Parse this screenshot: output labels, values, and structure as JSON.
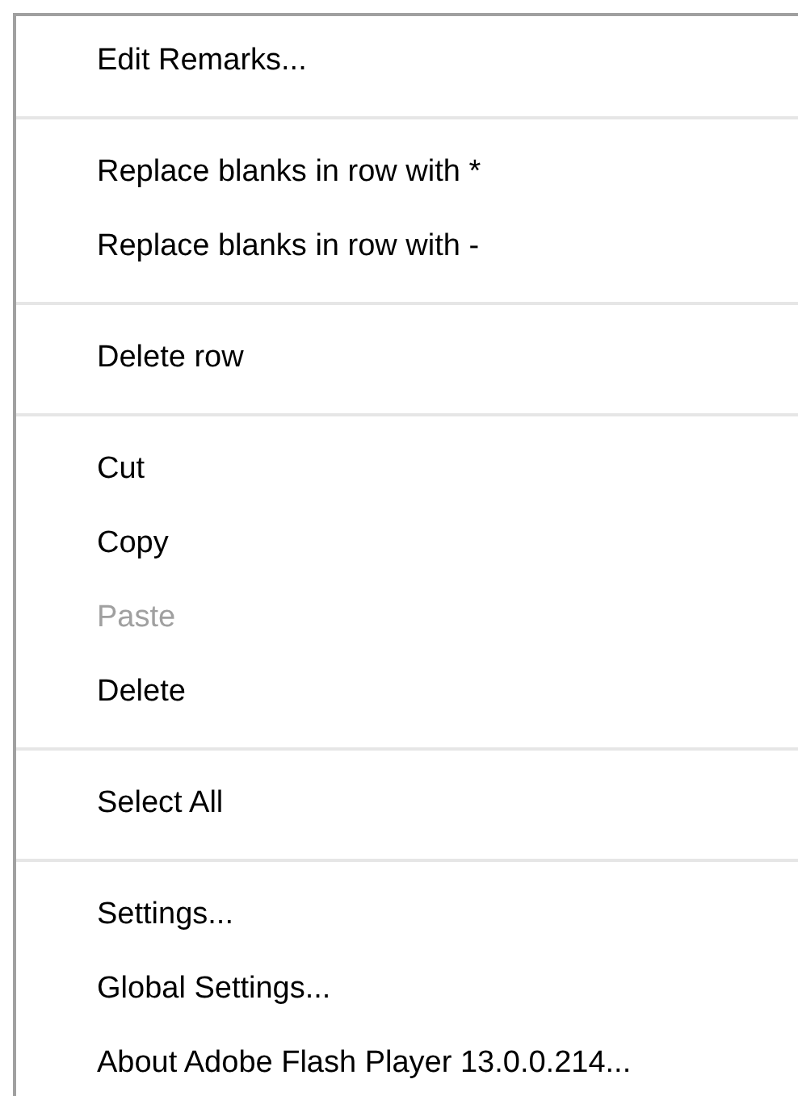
{
  "context_menu": {
    "entries": [
      {
        "kind": "item",
        "label": "Edit Remarks...",
        "disabled": false
      },
      {
        "kind": "separator"
      },
      {
        "kind": "item",
        "label": "Replace blanks in row with *",
        "disabled": false
      },
      {
        "kind": "item",
        "label": "Replace blanks in row with -",
        "disabled": false
      },
      {
        "kind": "separator"
      },
      {
        "kind": "item",
        "label": "Delete row",
        "disabled": false
      },
      {
        "kind": "separator"
      },
      {
        "kind": "item",
        "label": "Cut",
        "disabled": false
      },
      {
        "kind": "item",
        "label": "Copy",
        "disabled": false
      },
      {
        "kind": "item",
        "label": "Paste",
        "disabled": true
      },
      {
        "kind": "item",
        "label": "Delete",
        "disabled": false
      },
      {
        "kind": "separator"
      },
      {
        "kind": "item",
        "label": "Select All",
        "disabled": false
      },
      {
        "kind": "separator"
      },
      {
        "kind": "item",
        "label": "Settings...",
        "disabled": false
      },
      {
        "kind": "item",
        "label": "Global Settings...",
        "disabled": false
      },
      {
        "kind": "item",
        "label": "About Adobe Flash Player 13.0.0.214...",
        "disabled": false
      }
    ]
  }
}
